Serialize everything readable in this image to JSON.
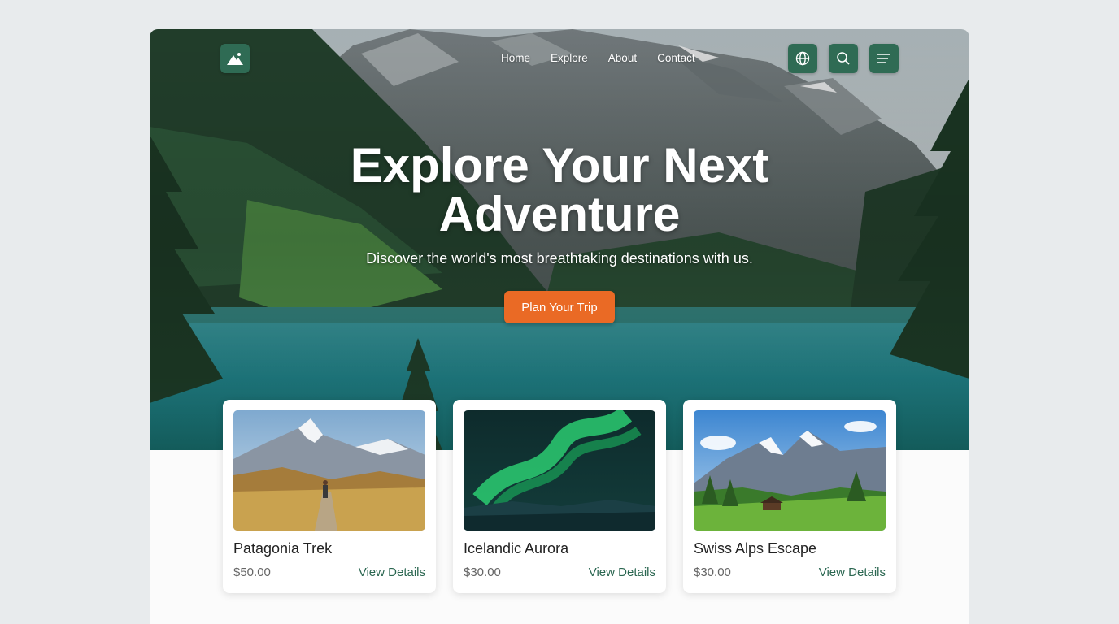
{
  "nav": {
    "items": [
      {
        "label": "Home"
      },
      {
        "label": "Explore"
      },
      {
        "label": "About"
      },
      {
        "label": "Contact"
      }
    ]
  },
  "header_icons": [
    "globe-icon",
    "search-icon",
    "menu-icon"
  ],
  "hero": {
    "title_line1": "Explore Your Next",
    "title_line2": "Adventure",
    "subtitle": "Discover the world's most breathtaking destinations with us.",
    "cta_label": "Plan Your Trip"
  },
  "cards": [
    {
      "title": "Patagonia Trek",
      "price": "$50.00",
      "link": "View Details"
    },
    {
      "title": "Icelandic Aurora",
      "price": "$30.00",
      "link": "View Details"
    },
    {
      "title": "Swiss Alps Escape",
      "price": "$30.00",
      "link": "View Details"
    }
  ],
  "colors": {
    "brand_green": "#2f6b54",
    "cta_orange": "#ea6a25",
    "link_green": "#2a6650",
    "background": "#e8ebed"
  }
}
